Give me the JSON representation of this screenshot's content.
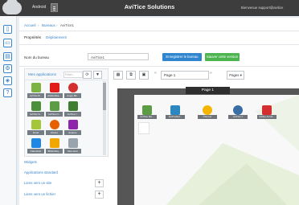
{
  "header": {
    "os_label": "Android",
    "title": "AviTice Solutions",
    "welcome": "Bienvenue support@avitice"
  },
  "breadcrumb": {
    "home": "Accueil",
    "sep1": "›",
    "section": "Bureaux",
    "sep2": "›",
    "current": "AviTice1"
  },
  "tabs": [
    {
      "label": "Propriétés"
    },
    {
      "label": "Déploiement"
    }
  ],
  "form": {
    "name_label": "Nom du bureau",
    "name_value": "AviTice1",
    "save_label": "Enregistrer le bureau",
    "save_version_label": "Sauver cette version"
  },
  "apps_panel": {
    "title": "Mes applications",
    "filter_placeholder": "Filtrer...",
    "tools": [
      "⟳",
      "▼"
    ],
    "apps": [
      {
        "label": "AviTice B...",
        "icon": "graduate-icon"
      },
      {
        "label": "AdobeRea...",
        "icon": "pdf-icon"
      },
      {
        "label": "Angry Bir...",
        "icon": "bird-icon"
      },
      {
        "label": "AviTice S...",
        "icon": "graduate-icon"
      },
      {
        "label": "AviTice N...",
        "icon": "graduate-icon"
      },
      {
        "label": "AviTice I...",
        "icon": "graduate-icon"
      },
      {
        "label": "Droid",
        "icon": "android-icon"
      },
      {
        "label": "Firefox",
        "icon": "firefox-icon"
      },
      {
        "label": "Explore",
        "icon": "circle-icon"
      },
      {
        "label": "Calendrier",
        "icon": "calendar-icon"
      },
      {
        "label": "Bibliothèq...",
        "icon": "books-icon"
      },
      {
        "label": "Mes docs",
        "icon": "folder-icon"
      }
    ]
  },
  "side_items": [
    {
      "label": "Widgets"
    },
    {
      "label": "Applications standard"
    },
    {
      "label": "Liens vers un site",
      "plus": "+"
    },
    {
      "label": "Liens vers un fichier",
      "plus": "+"
    }
  ],
  "workspace": {
    "prev": "«",
    "page_select": "Page 1",
    "next": "»",
    "pages_label": "Pages ▾",
    "page_tab": "Page 1"
  },
  "desktop_apps": [
    {
      "label": "AviTice Mo...",
      "icon": "graduate-icon"
    },
    {
      "label": "AviTiceSol...",
      "icon": "map-icon"
    },
    {
      "label": "Chrome",
      "icon": "chrome-icon"
    },
    {
      "label": "AviTice 1",
      "icon": "globe-icon"
    },
    {
      "label": "Adobe Acrob...",
      "icon": "pdf-icon"
    }
  ]
}
